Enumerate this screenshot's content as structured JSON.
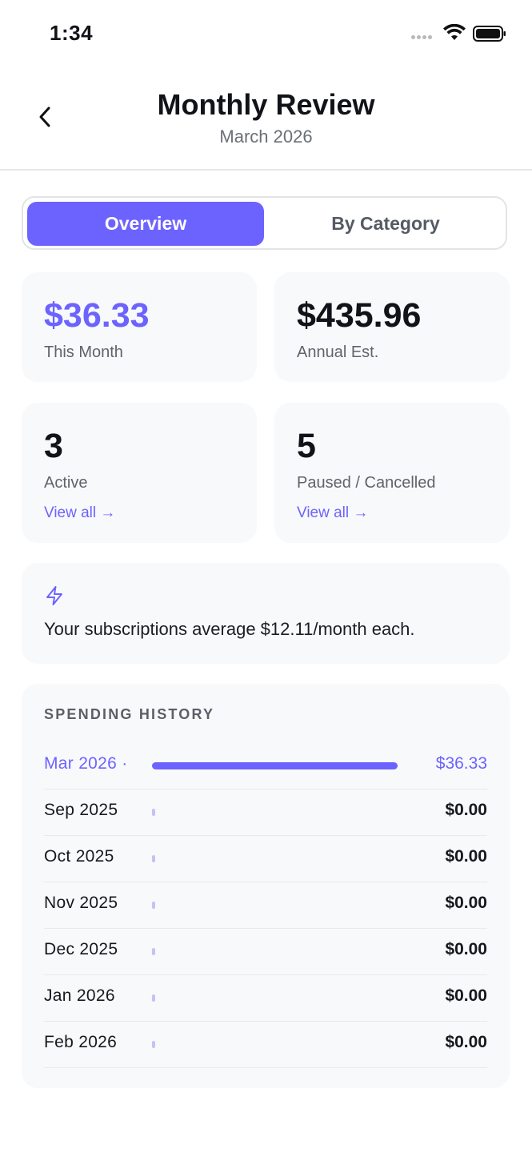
{
  "status_bar": {
    "time": "1:34"
  },
  "header": {
    "title": "Monthly Review",
    "subtitle": "March 2026"
  },
  "tabs": [
    {
      "label": "Overview",
      "active": true
    },
    {
      "label": "By Category",
      "active": false
    }
  ],
  "stats": {
    "this_month": {
      "value": "$36.33",
      "label": "This Month"
    },
    "annual": {
      "value": "$435.96",
      "label": "Annual Est."
    },
    "active": {
      "value": "3",
      "label": "Active",
      "link": "View all →"
    },
    "paused": {
      "value": "5",
      "label": "Paused / Cancelled",
      "link": "View all →"
    }
  },
  "insight": {
    "icon": "bolt-icon",
    "text": "Your subscriptions average $12.11/month each."
  },
  "history": {
    "heading": "SPENDING HISTORY",
    "rows": [
      {
        "label": "Mar 2026 ·",
        "value": "$36.33",
        "fraction": 1.0,
        "current": true
      },
      {
        "label": "Sep 2025",
        "value": "$0.00",
        "fraction": 0,
        "current": false
      },
      {
        "label": "Oct 2025",
        "value": "$0.00",
        "fraction": 0,
        "current": false
      },
      {
        "label": "Nov 2025",
        "value": "$0.00",
        "fraction": 0,
        "current": false
      },
      {
        "label": "Dec 2025",
        "value": "$0.00",
        "fraction": 0,
        "current": false
      },
      {
        "label": "Jan 2026",
        "value": "$0.00",
        "fraction": 0,
        "current": false
      },
      {
        "label": "Feb 2026",
        "value": "$0.00",
        "fraction": 0,
        "current": false
      }
    ]
  },
  "colors": {
    "accent": "#6c63ff",
    "card_bg": "#f8f9fb",
    "muted_text": "#5f636b"
  }
}
